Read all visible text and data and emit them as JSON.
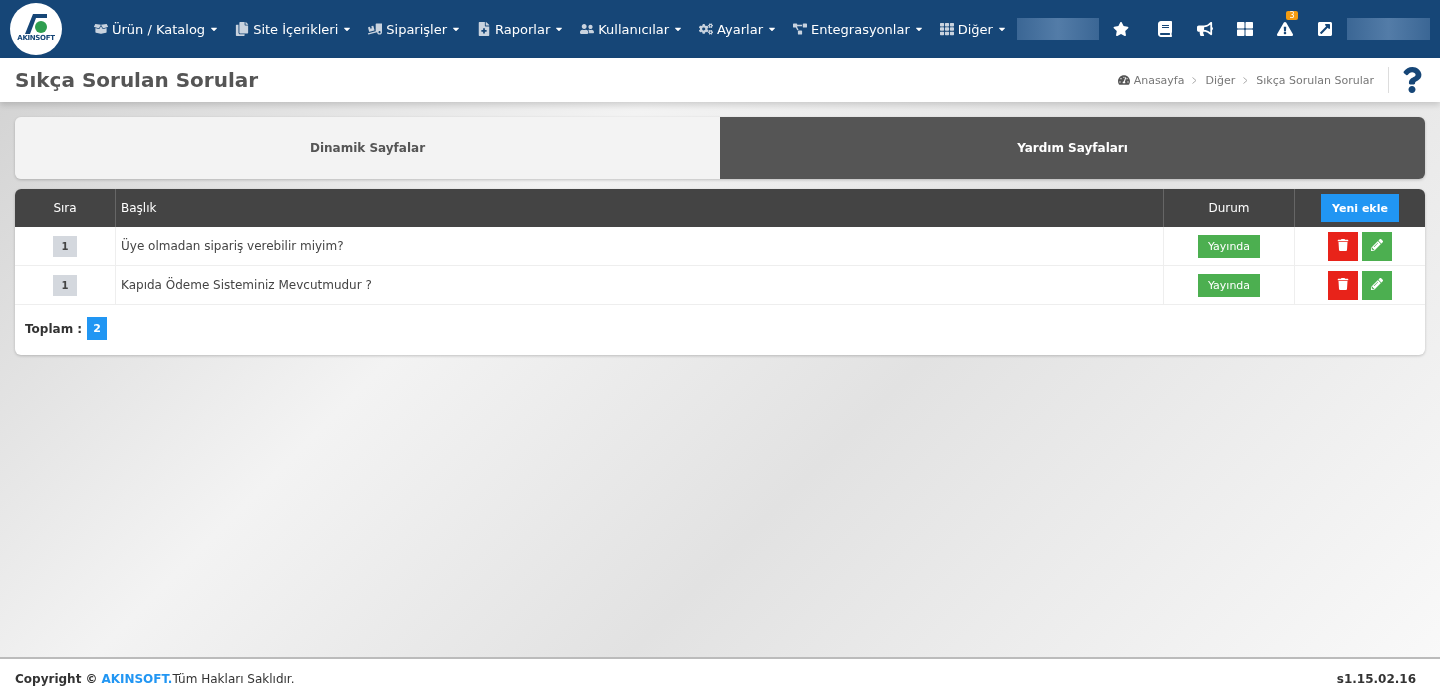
{
  "navbar": {
    "logo_text": "AKINSOFT",
    "menu": [
      {
        "label": "Ürün / Katalog"
      },
      {
        "label": "Site İçerikleri"
      },
      {
        "label": "Siparişler"
      },
      {
        "label": "Raporlar"
      },
      {
        "label": "Kullanıcılar"
      },
      {
        "label": "Ayarlar"
      },
      {
        "label": "Entegrasyonlar"
      },
      {
        "label": "Diğer"
      }
    ],
    "alert_count": "3"
  },
  "page_title": "Sıkça Sorulan Sorular",
  "breadcrumb": [
    "Anasayfa",
    "Diğer",
    "Sıkça Sorulan Sorular"
  ],
  "tabs": [
    {
      "label": "Dinamik Sayfalar",
      "selected": false
    },
    {
      "label": "Yardım Sayfaları",
      "selected": true
    }
  ],
  "table": {
    "columns": [
      "Sıra",
      "Başlık",
      "Durum"
    ],
    "add_button": "Yeni ekle",
    "rows": [
      {
        "order": "1",
        "title": "Üye olmadan sipariş verebilir miyim?",
        "status": "Yayında",
        "published": true
      },
      {
        "order": "1",
        "title": "Kapıda Ödeme Sisteminiz Mevcutmudur ?",
        "status": "Yayında",
        "published": true
      }
    ],
    "total_label": "Toplam :",
    "total": "2"
  },
  "footer": {
    "prefix": "Copyright ©",
    "brand": "AKINSOFT.",
    "suffix": "Tüm Hakları Saklıdır.",
    "version": "s1.15.02.16"
  }
}
